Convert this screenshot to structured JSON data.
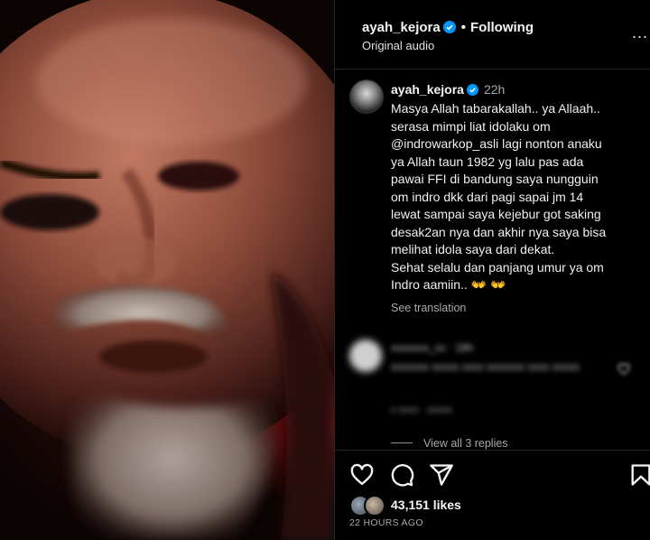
{
  "header": {
    "username": "ayah_kejora",
    "separator": "•",
    "follow_status": "Following",
    "audio": "Original audio",
    "more": "..."
  },
  "caption": {
    "username": "ayah_kejora",
    "time": "22h",
    "text": "Masya Allah tabarakallah.. ya Allaah..\nserasa mimpi liat idolaku om\n@indrowarkop_asli lagi nonton anaku\nya Allah taun 1982 yg lalu pas ada\npawai FFI di bandung saya nungguin\nom indro dkk dari pagi sapai jm 14\nlewat sampai saya kejebur got saking\ndesak2an nya dan akhir nya saya bisa\nmelihat idola saya dari dekat.\nSehat selalu dan panjang umur ya om\nIndro aamiin.. 👐 👐",
    "see_translation": "See translation"
  },
  "replies": {
    "view_all": "View all 3 replies"
  },
  "stats": {
    "likes": "43,151 likes",
    "posted": "22 HOURS AGO"
  },
  "icons": {
    "verified": "verified-badge-icon",
    "like": "heart-icon",
    "comment": "comment-icon",
    "share": "paper-plane-icon",
    "save": "bookmark-icon"
  },
  "colors": {
    "verified": "#0095f6",
    "background": "#000000",
    "muted_text": "#a8a8a8"
  }
}
